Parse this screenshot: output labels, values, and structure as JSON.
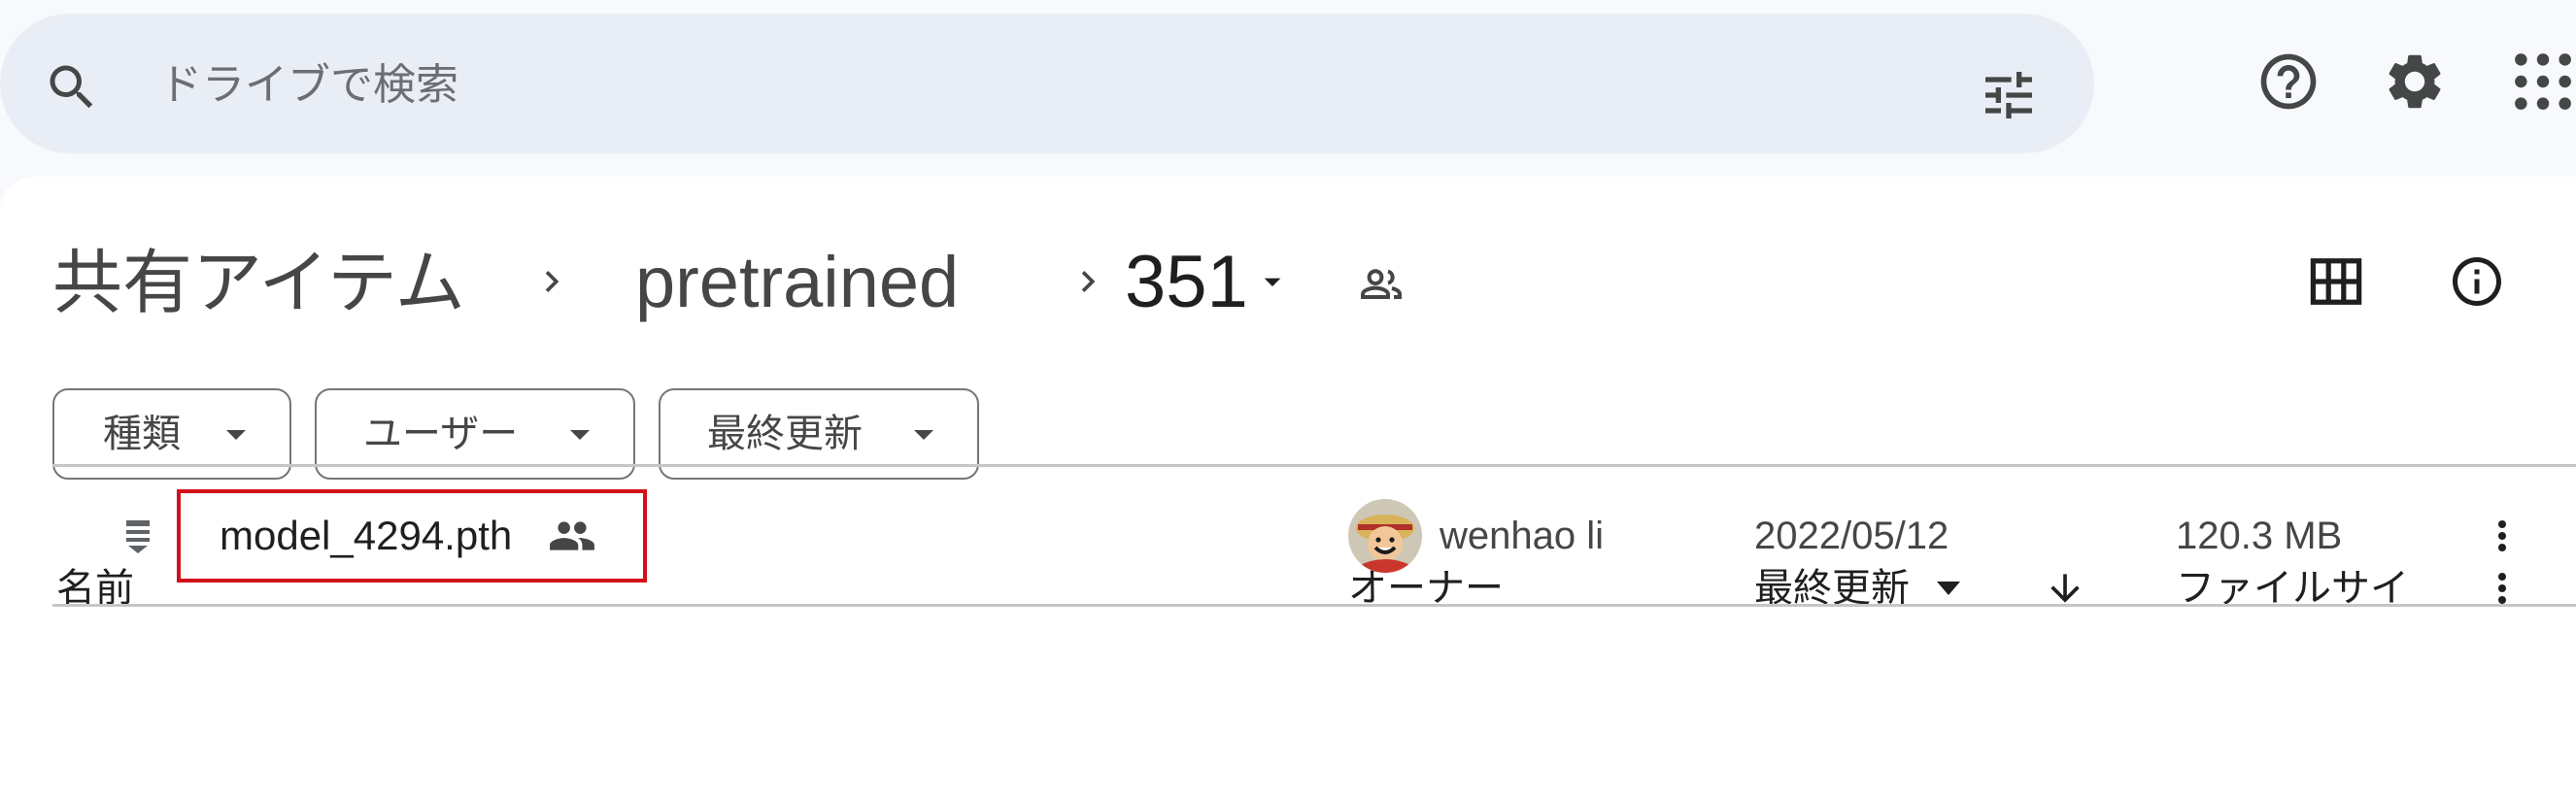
{
  "search": {
    "placeholder": "ドライブで検索"
  },
  "header_icons": [
    "search-icon",
    "filter-icon",
    "help-icon",
    "settings-icon",
    "apps-icon"
  ],
  "breadcrumb": {
    "items": [
      "共有アイテム",
      "pretrained",
      "351"
    ]
  },
  "view_icons": [
    "grid-view-icon",
    "info-icon"
  ],
  "filters": {
    "type_label": "種類",
    "user_label": "ユーザー",
    "modified_label": "最終更新"
  },
  "table": {
    "headers": {
      "name": "名前",
      "owner": "オーナー",
      "modified": "最終更新",
      "size": "ファイルサイ"
    },
    "rows": [
      {
        "name": "model_4294.pth",
        "owner": "wenhao li",
        "modified": "2022/05/12",
        "size": "120.3 MB"
      }
    ]
  },
  "colors": {
    "search_bg": "#e9eef6",
    "highlight": "#d3101a",
    "divider": "#c4c7c5"
  }
}
